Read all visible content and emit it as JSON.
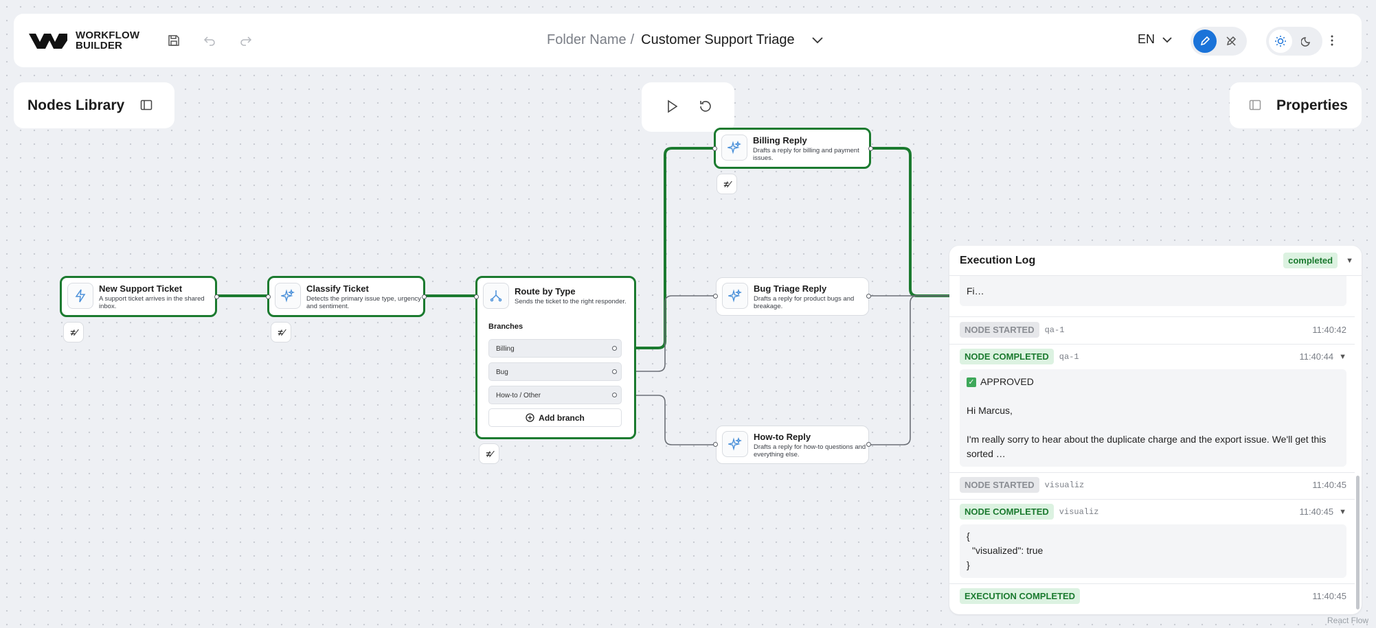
{
  "header": {
    "logo_line1": "WORKFLOW",
    "logo_line2": "BUILDER",
    "folder": "Folder Name",
    "separator": "/",
    "workflow_name": "Customer Support Triage",
    "language": "EN"
  },
  "nodes_library": {
    "title": "Nodes Library"
  },
  "properties": {
    "title": "Properties"
  },
  "nodes": {
    "trigger": {
      "title": "New Support Ticket",
      "desc": "A support ticket arrives in the shared inbox."
    },
    "classify": {
      "title": "Classify Ticket",
      "desc": "Detects the primary issue type, urgency and sentiment."
    },
    "route": {
      "title": "Route by Type",
      "desc": "Sends the ticket to the right responder.",
      "branches_title": "Branches",
      "branches": [
        "Billing",
        "Bug",
        "How-to / Other"
      ],
      "add_branch": "Add branch"
    },
    "billing": {
      "title": "Billing Reply",
      "desc": "Drafts a reply for billing and payment issues."
    },
    "bug": {
      "title": "Bug Triage Reply",
      "desc": "Drafts a reply for product bugs and breakage."
    },
    "howto": {
      "title": "How-to Reply",
      "desc": "Drafts a reply for how-to questions and everything else."
    }
  },
  "execution_log": {
    "title": "Execution Log",
    "status": "completed",
    "truncated_text": "Fi…",
    "entries": [
      {
        "type": "NODE STARTED",
        "node": "qa-1",
        "time": "11:40:42"
      },
      {
        "type": "NODE COMPLETED",
        "node": "qa-1",
        "time": "11:40:44",
        "output": [
          "✅ APPROVED",
          "Hi Marcus,",
          "I'm really sorry to hear about the duplicate charge and the export issue. We'll get this sorted …"
        ]
      },
      {
        "type": "NODE STARTED",
        "node": "visualiz",
        "time": "11:40:45"
      },
      {
        "type": "NODE COMPLETED",
        "node": "visualiz",
        "time": "11:40:45",
        "output": [
          "{",
          "\"visualized\": true",
          "}"
        ]
      },
      {
        "type": "EXECUTION COMPLETED",
        "time": "11:40:45"
      }
    ]
  },
  "attribution": "React Flow",
  "colors": {
    "active_edge": "#1b7a2f",
    "accent_blue": "#1a73d9",
    "node_icon": "#4a90d9"
  }
}
